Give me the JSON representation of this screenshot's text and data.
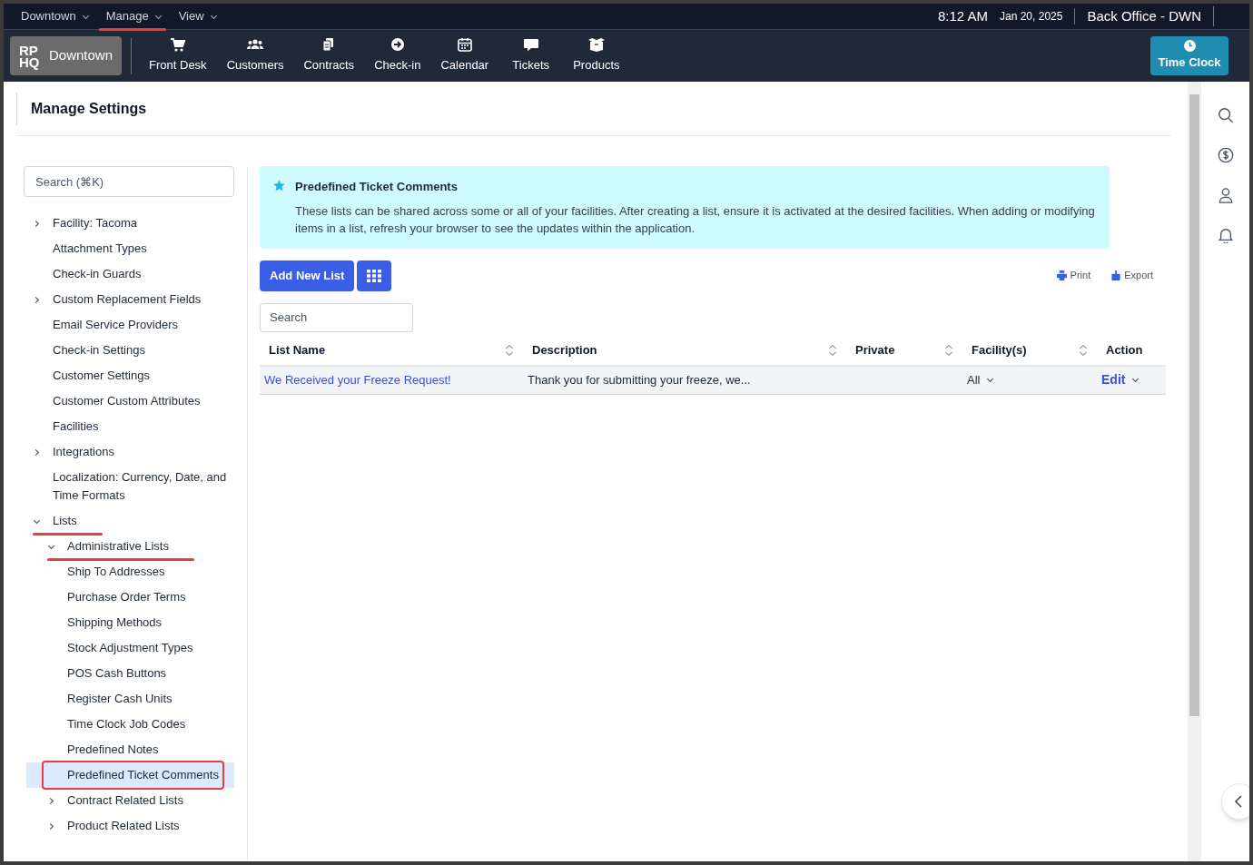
{
  "top_bar": {
    "menus": [
      {
        "label": "Downtown",
        "annotated": false
      },
      {
        "label": "Manage",
        "annotated": true
      },
      {
        "label": "View",
        "annotated": false
      }
    ],
    "time": "8:12 AM",
    "date": "Jan 20, 2025",
    "location": "Back Office - DWN"
  },
  "nav": {
    "logo": "RP HQ",
    "facility": "Downtown",
    "items": [
      {
        "label": "Front Desk"
      },
      {
        "label": "Customers"
      },
      {
        "label": "Contracts"
      },
      {
        "label": "Check-in"
      },
      {
        "label": "Calendar"
      },
      {
        "label": "Tickets"
      },
      {
        "label": "Products"
      }
    ],
    "time_clock": "Time Clock"
  },
  "page_title": "Manage Settings",
  "sidebar": {
    "search_placeholder": "Search (⌘K)",
    "items": [
      {
        "label": "Facility: Tacoma",
        "expanded": false,
        "selected": false
      },
      {
        "label": "Attachment Types",
        "selected": false
      },
      {
        "label": "Check-in Guards",
        "selected": false
      },
      {
        "label": "Custom Replacement Fields",
        "expanded": false,
        "selected": false
      },
      {
        "label": "Email Service Providers",
        "selected": false
      },
      {
        "label": "Check-in Settings",
        "selected": false
      },
      {
        "label": "Customer Settings",
        "selected": false
      },
      {
        "label": "Customer Custom Attributes",
        "selected": false
      },
      {
        "label": "Facilities",
        "selected": false
      },
      {
        "label": "Integrations",
        "expanded": false,
        "selected": false
      },
      {
        "label": "Localization: Currency, Date, and Time Formats",
        "selected": false
      },
      {
        "label": "Lists",
        "expanded": true,
        "selected": false,
        "annotated": true,
        "children": [
          {
            "label": "Administrative Lists",
            "expanded": true,
            "selected": false,
            "annotated": true,
            "children": [
              {
                "label": "Ship To Addresses",
                "selected": false
              },
              {
                "label": "Purchase Order Terms",
                "selected": false
              },
              {
                "label": "Shipping Methods",
                "selected": false
              },
              {
                "label": "Stock Adjustment Types",
                "selected": false
              },
              {
                "label": "POS Cash Buttons",
                "selected": false
              },
              {
                "label": "Register Cash Units",
                "selected": false
              },
              {
                "label": "Time Clock Job Codes",
                "selected": false
              },
              {
                "label": "Predefined Notes",
                "selected": false
              },
              {
                "label": "Predefined Ticket Comments",
                "selected": true,
                "annotated": true
              }
            ]
          },
          {
            "label": "Contract Related Lists",
            "expanded": false,
            "selected": false
          },
          {
            "label": "Product Related Lists",
            "expanded": false,
            "selected": false
          }
        ]
      }
    ]
  },
  "info": {
    "title": "Predefined Ticket Comments",
    "text": "These lists can be shared across some or all of your facilities. After creating a list, ensure it is activated at the desired facilities. When adding or modifying items in a list, refresh your browser to see the updates within the application."
  },
  "toolbar": {
    "add_button": "Add New List",
    "print": "Print",
    "export": "Export",
    "search_placeholder": "Search"
  },
  "table": {
    "columns": [
      {
        "label": "List Name",
        "sortable": true
      },
      {
        "label": "Description",
        "sortable": true
      },
      {
        "label": "Private",
        "sortable": true
      },
      {
        "label": "Facility(s)",
        "sortable": true
      },
      {
        "label": "Action",
        "sortable": false
      }
    ],
    "rows": [
      {
        "list_name": "We Received your Freeze Request!",
        "description": "Thank you for submitting your freeze, we...",
        "facilities": "All",
        "action": "Edit"
      }
    ]
  }
}
